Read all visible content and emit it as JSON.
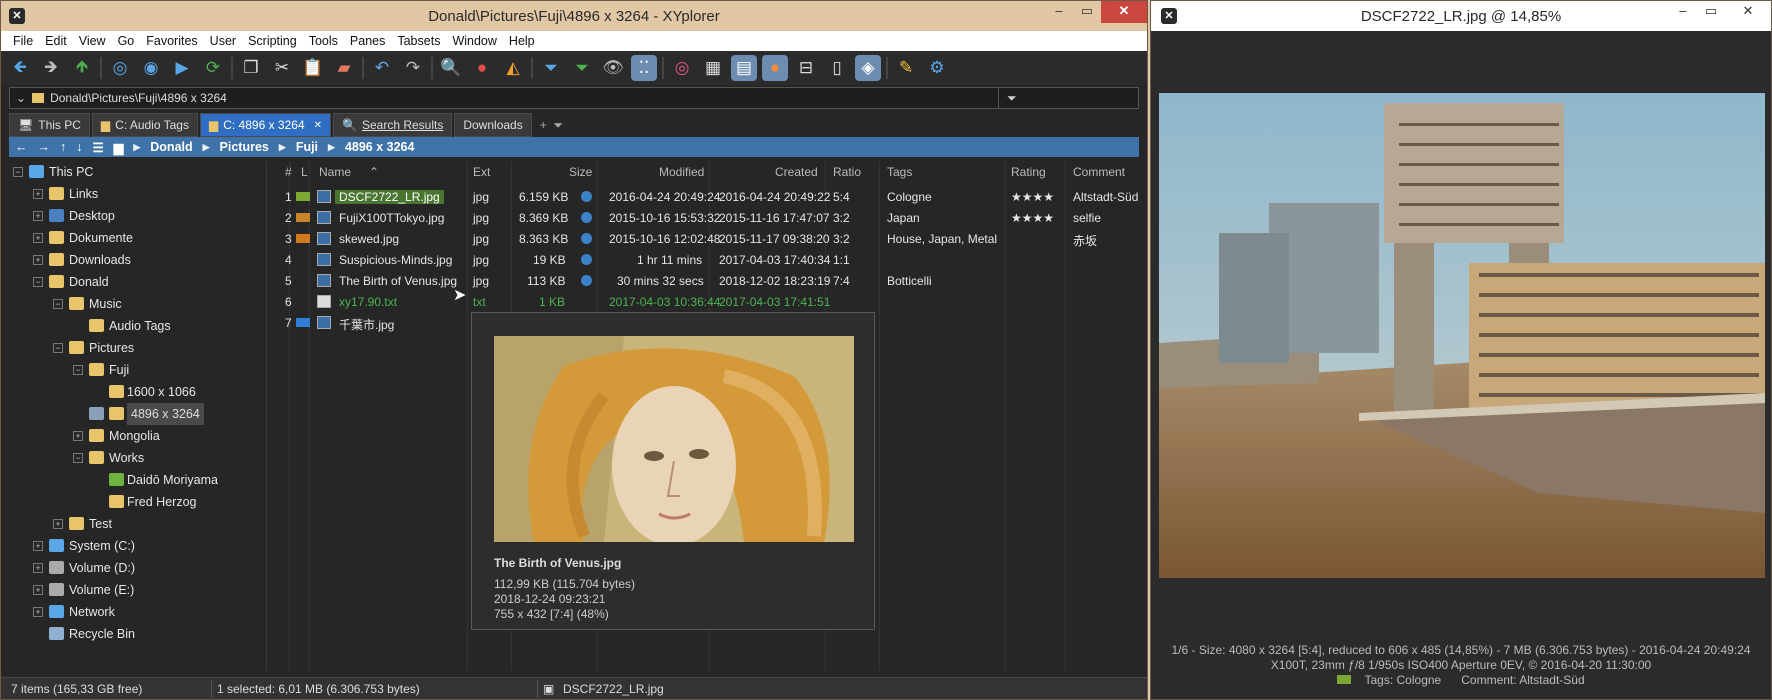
{
  "main": {
    "title": "Donald\\Pictures\\Fuji\\4896 x 3264 - XYplorer",
    "menu": [
      "File",
      "Edit",
      "View",
      "Go",
      "Favorites",
      "User",
      "Scripting",
      "Tools",
      "Panes",
      "Tabsets",
      "Window",
      "Help"
    ],
    "address": "Donald\\Pictures\\Fuji\\4896 x 3264",
    "tabs": [
      {
        "label": "This PC"
      },
      {
        "label": "C: Audio Tags"
      },
      {
        "label": "C: 4896 x 3264"
      },
      {
        "label": "Search Results"
      },
      {
        "label": "Downloads"
      }
    ],
    "breadcrumb": [
      "Donald",
      "Pictures",
      "Fuji",
      "4896 x 3264"
    ],
    "tree": [
      {
        "label": "This PC"
      },
      {
        "label": "Links"
      },
      {
        "label": "Desktop"
      },
      {
        "label": "Dokumente"
      },
      {
        "label": "Downloads"
      },
      {
        "label": "Donald"
      },
      {
        "label": "Music"
      },
      {
        "label": "Audio Tags"
      },
      {
        "label": "Pictures"
      },
      {
        "label": "Fuji"
      },
      {
        "label": "1600 x 1066"
      },
      {
        "label": "4896 x 3264"
      },
      {
        "label": "Mongolia"
      },
      {
        "label": "Works"
      },
      {
        "label": "Daidō Moriyama"
      },
      {
        "label": "Fred Herzog"
      },
      {
        "label": "Test"
      },
      {
        "label": "System (C:)"
      },
      {
        "label": "Volume (D:)"
      },
      {
        "label": "Volume (E:)"
      },
      {
        "label": "Network"
      },
      {
        "label": "Recycle Bin"
      }
    ],
    "columns": {
      "num": "#",
      "label": "L",
      "name": "Name",
      "ext": "Ext",
      "size": "Size",
      "modified": "Modified",
      "created": "Created",
      "ratio": "Ratio",
      "tags": "Tags",
      "rating": "Rating",
      "comment": "Comment"
    },
    "files": [
      {
        "num": "1",
        "name": "DSCF2722_LR.jpg",
        "ext": "jpg",
        "size": "6.159 KB",
        "modified": "2016-04-24 20:49:24",
        "created": "2016-04-24 20:49:22",
        "ratio": "5:4",
        "tags": "Cologne",
        "rating": "★★★★",
        "comment": "Altstadt-Süd",
        "label_color": "#7ea834"
      },
      {
        "num": "2",
        "name": "FujiX100TTokyo.jpg",
        "ext": "jpg",
        "size": "8.369 KB",
        "modified": "2015-10-16 15:53:32",
        "created": "2015-11-16 17:47:07",
        "ratio": "3:2",
        "tags": "Japan",
        "rating": "★★★★",
        "comment": "selfie",
        "label_color": "#c8852a"
      },
      {
        "num": "3",
        "name": "skewed.jpg",
        "ext": "jpg",
        "size": "8.363 KB",
        "modified": "2015-10-16 12:02:48",
        "created": "2015-11-17 09:38:20",
        "ratio": "3:2",
        "tags": "House, Japan, Metal",
        "rating": "",
        "comment": "赤坂",
        "label_color": "#d07a1e"
      },
      {
        "num": "4",
        "name": "Suspicious-Minds.jpg",
        "ext": "jpg",
        "size": "19 KB",
        "modified": "1 hr  11 mins",
        "created": "2017-04-03 17:40:34",
        "ratio": "1:1",
        "tags": "",
        "rating": "",
        "comment": "",
        "label_color": ""
      },
      {
        "num": "5",
        "name": "The Birth of Venus.jpg",
        "ext": "jpg",
        "size": "113 KB",
        "modified": "30 mins  32 secs",
        "created": "2018-12-02 18:23:19",
        "ratio": "7:4",
        "tags": "Botticelli",
        "rating": "",
        "comment": "",
        "label_color": ""
      },
      {
        "num": "6",
        "name": "xy17.90.txt",
        "ext": "txt",
        "size": "1 KB",
        "modified": "2017-04-03 10:36:44",
        "created": "2017-04-03 17:41:51",
        "ratio": "",
        "tags": "",
        "rating": "",
        "comment": "",
        "label_color": ""
      },
      {
        "num": "7",
        "name": "千葉市.jpg",
        "ext": "",
        "size": "",
        "modified": "",
        "created": "",
        "ratio": "",
        "tags": "",
        "rating": "",
        "comment": "",
        "label_color": "#2f7fd6"
      }
    ],
    "tooltip": {
      "title": "The Birth of Venus.jpg",
      "size": "112,99 KB (115.704 bytes)",
      "date": "2018-12-24 09:23:21",
      "dims": "755 x 432  [7:4]  (48%)"
    },
    "status": {
      "items": "7 items (165,33 GB free)",
      "selected": "1 selected: 6,01 MB (6.306.753 bytes)",
      "file": "DSCF2722_LR.jpg"
    }
  },
  "viewer": {
    "title": "DSCF2722_LR.jpg @ 14,85%",
    "info_line1": "1/6 - Size: 4080 x 3264 [5:4], reduced to 606 x 485 (14,85%) - 7 MB (6.306.753 bytes) - 2016-04-24 20:49:24",
    "info_line2": "X100T, 23mm  ƒ/8  1/950s  ISO400  Aperture  0EV, © 2016-04-20 11:30:00",
    "info_tags": "Tags: Cologne",
    "info_comment": "Comment: Altstadt-Süd"
  },
  "colors": {
    "accent": "#2f6ec2",
    "breadcrumb": "#3f72a8",
    "title_bg": "#e1c7a3",
    "selection_green": "#48762e"
  }
}
